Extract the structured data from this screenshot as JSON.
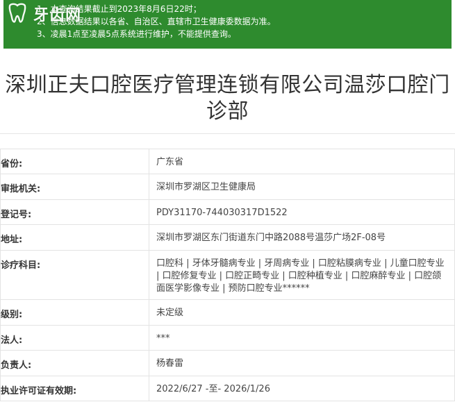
{
  "notice": {
    "lines": [
      "1、本查询结果截止到2023年8月6日22时；",
      "2、信息数据结果以各省、自治区、直辖市卫生健康委数据为准。",
      "3、凌晨1点至凌晨5点系统进行维护，不能提供查询。"
    ]
  },
  "logo": {
    "text": "牙齿网"
  },
  "title": "深圳正夫口腔医疗管理连锁有限公司温莎口腔门诊部",
  "rows": [
    {
      "label": "省份:",
      "value": "广东省"
    },
    {
      "label": "审批机关:",
      "value": "深圳市罗湖区卫生健康局"
    },
    {
      "label": "登记号:",
      "value": "PDY31170-744030317D1522"
    },
    {
      "label": "地址:",
      "value": "深圳市罗湖区东门街道东门中路2088号温莎广场2F-08号"
    },
    {
      "label": "诊疗科目:",
      "value": "口腔科 | 牙体牙髓病专业 | 牙周病专业 | 口腔粘膜病专业 | 儿童口腔专业 | 口腔修复专业 | 口腔正畸专业 | 口腔种植专业 | 口腔麻醉专业 | 口腔颌面医学影像专业 | 预防口腔专业******"
    },
    {
      "label": "级别:",
      "value": "未定级"
    },
    {
      "label": "法人:",
      "value": "***"
    },
    {
      "label": "负责人:",
      "value": "杨春雷"
    },
    {
      "label": "执业许可证有效期:",
      "value": "2022/6/27 -至- 2026/1/26"
    }
  ]
}
